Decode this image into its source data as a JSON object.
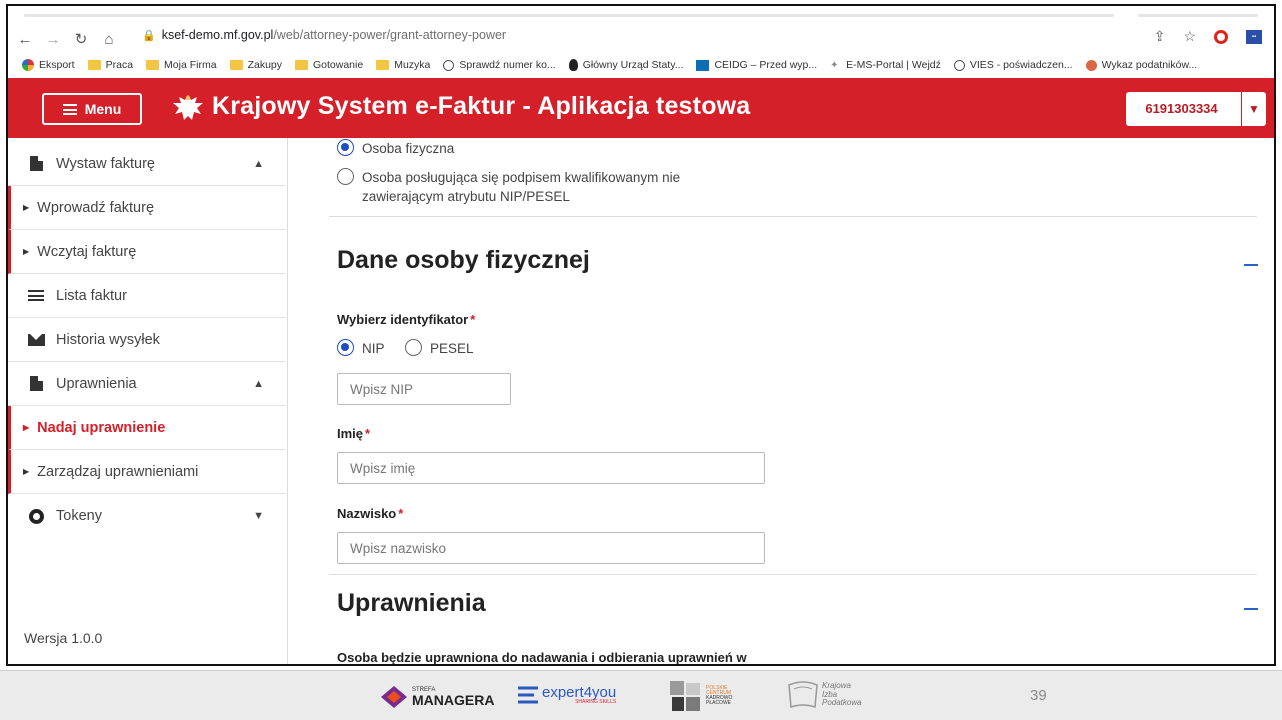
{
  "browser": {
    "url_host": "ksef-demo.mf.gov.pl",
    "url_path": "/web/attorney-power/grant-attorney-power",
    "bookmarks": [
      "Eksport",
      "Praca",
      "Moja Firma",
      "Zakupy",
      "Gotowanie",
      "Muzyka",
      "Sprawdź numer ko...",
      "Główny Urząd Staty...",
      "CEIDG – Przed wyp...",
      "E-MS-Portal | Wejdź",
      "VIES - poświadczen...",
      "Wykaz podatników..."
    ]
  },
  "header": {
    "menu_label": "Menu",
    "title": "Krajowy System e-Faktur - Aplikacja testowa",
    "nip": "6191303334",
    "brand_color": "#d5202a"
  },
  "sidebar": {
    "items": [
      {
        "label": "Wystaw fakturę",
        "icon": "document-icon"
      },
      {
        "label": "Wprowadź fakturę"
      },
      {
        "label": "Wczytaj fakturę"
      },
      {
        "label": "Lista faktur",
        "icon": "list-icon"
      },
      {
        "label": "Historia wysyłek",
        "icon": "envelope-icon"
      },
      {
        "label": "Uprawnienia",
        "icon": "document-icon"
      },
      {
        "label": "Nadaj uprawnienie",
        "active": true
      },
      {
        "label": "Zarządzaj uprawnieniami"
      },
      {
        "label": "Tokeny",
        "icon": "token-icon"
      }
    ],
    "version": "Wersja 1.0.0"
  },
  "main": {
    "person_type": {
      "options": [
        "Osoba fizyczna",
        "Osoba posługująca się podpisem kwalifikowanym nie zawierającym atrybutu NIP/PESEL"
      ],
      "selected": "Osoba fizyczna"
    },
    "section_person": {
      "title": "Dane osoby fizycznej",
      "identifier_label": "Wybierz identyfikator",
      "identifier_options": [
        "NIP",
        "PESEL"
      ],
      "identifier_selected": "NIP",
      "nip_placeholder": "Wpisz NIP",
      "first_name_label": "Imię",
      "first_name_placeholder": "Wpisz imię",
      "last_name_label": "Nazwisko",
      "last_name_placeholder": "Wpisz nazwisko",
      "required_mark": "*"
    },
    "section_rights": {
      "title": "Uprawnienia",
      "description_partial": "Osoba będzie uprawniona do nadawania i odbierania uprawnień w"
    }
  },
  "footer": {
    "logos": {
      "strefa_small": "STREFA",
      "strefa_big": "MANAGERA",
      "expert": "expert4you",
      "expert_sub": "SHARING SKILLS",
      "pck_line1": "POLSKIE",
      "pck_line2": "CENTRUM",
      "pck_line3": "KADROWO",
      "pck_line4": "PŁACOWE",
      "kip_line1": "Krajowa",
      "kip_line2": "Izba",
      "kip_line3": "Podatkowa"
    },
    "page_number": "39"
  }
}
